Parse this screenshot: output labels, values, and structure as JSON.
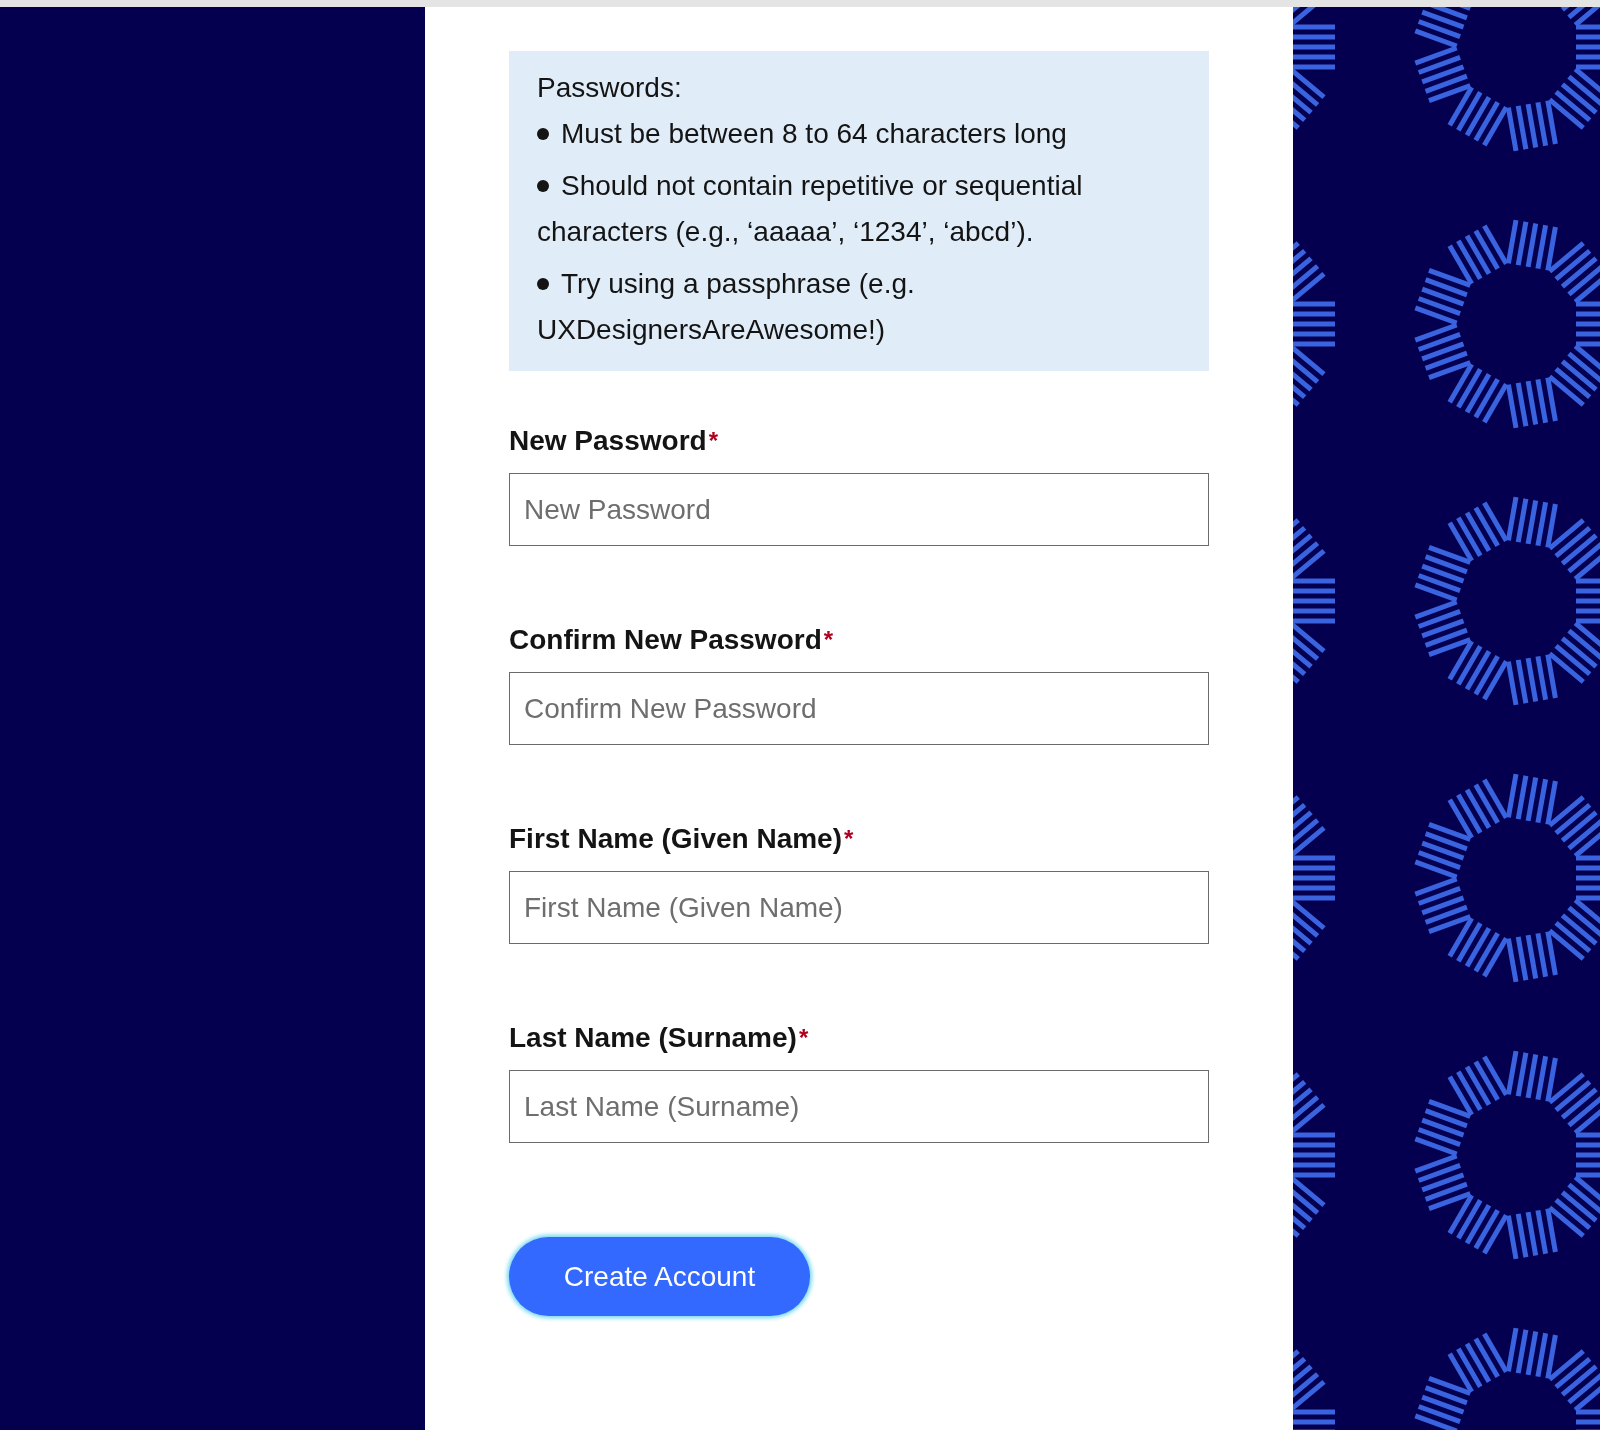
{
  "requirements": {
    "title": "Passwords:",
    "items": [
      "Must be between 8 to 64 characters long",
      "Should not contain repetitive or sequential characters (e.g., ‘aaaaa’, ‘1234’, ‘abcd’).",
      "Try using a passphrase (e.g. UXDesignersAreAwesome!)"
    ]
  },
  "fields": [
    {
      "label": "New Password",
      "required_mark": "*",
      "placeholder": "New Password"
    },
    {
      "label": "Confirm New Password",
      "required_mark": "*",
      "placeholder": "Confirm New Password"
    },
    {
      "label": "First Name (Given Name)",
      "required_mark": "*",
      "placeholder": "First Name (Given Name)"
    },
    {
      "label": "Last Name (Surname)",
      "required_mark": "*",
      "placeholder": "Last Name (Surname)"
    }
  ],
  "submit": {
    "label": "Create Account"
  }
}
